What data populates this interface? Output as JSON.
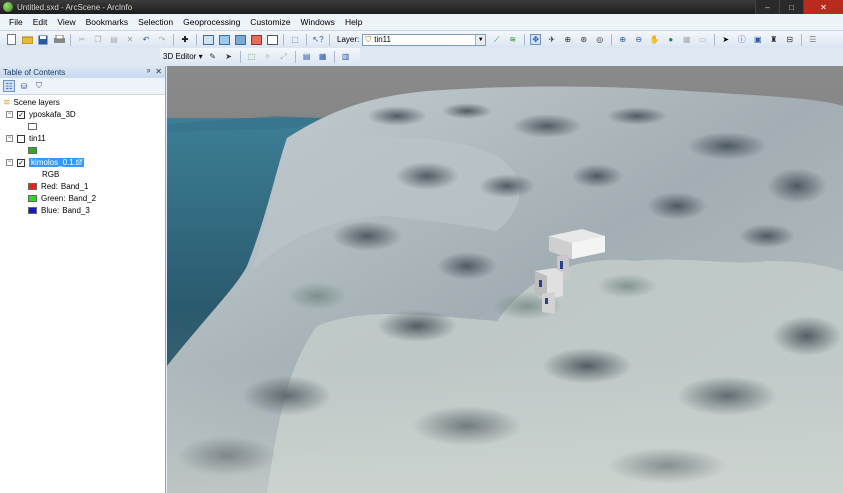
{
  "window": {
    "title": "Untitled.sxd - ArcScene - ArcInfo",
    "min": "–",
    "max": "□",
    "close": "✕"
  },
  "menu": [
    "File",
    "Edit",
    "View",
    "Bookmarks",
    "Selection",
    "Geoprocessing",
    "Customize",
    "Windows",
    "Help"
  ],
  "toolbar": {
    "layer_label": "Layer:",
    "layer_value": "tin11"
  },
  "editor_toolbar": {
    "label": "3D Editor ▾"
  },
  "toc": {
    "title": "Table of Contents",
    "pin": "ᵖ",
    "close": "✕",
    "root_label": "Scene layers",
    "layers": [
      {
        "name": "yposkafa_3D",
        "checked": true,
        "swatch": "#ffffff"
      },
      {
        "name": "tin11",
        "checked": false,
        "swatch": "#2eaa1a"
      },
      {
        "name": "kimolos_0.1.tif",
        "checked": true,
        "selected": true,
        "legend_title": "RGB",
        "bands": [
          {
            "channel": "Red:",
            "band": "Band_1",
            "color": "#e8211a"
          },
          {
            "channel": "Green:",
            "band": "Band_2",
            "color": "#22dd22"
          },
          {
            "channel": "Blue:",
            "band": "Band_3",
            "color": "#1a1ab8"
          }
        ]
      }
    ]
  },
  "colors": {
    "sky": "#7a7a7a",
    "sea": "#2a5a6e",
    "terrain": "#a9b4b8",
    "selection": "#3399ff"
  }
}
